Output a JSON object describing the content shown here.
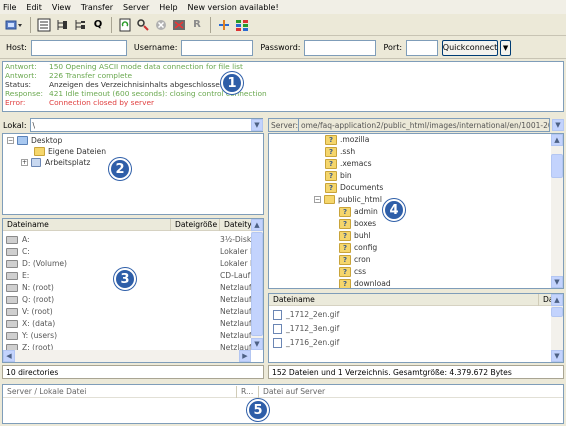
{
  "menu": [
    "File",
    "Edit",
    "View",
    "Transfer",
    "Server",
    "Help",
    "New version available!"
  ],
  "toolbar": {
    "icons": [
      "site-manager-icon",
      "dropdown-arrow-icon",
      "toggle-log-icon",
      "toggle-local-tree-icon",
      "toggle-remote-tree-icon",
      "toggle-queue-icon",
      "refresh-icon",
      "process-queue-icon",
      "cancel-icon",
      "disconnect-icon",
      "reconnect-icon",
      "filter-icon",
      "compare-icon"
    ],
    "queue_glyph": "Q",
    "reconnect_glyph": "R"
  },
  "quickconnect": {
    "host_label": "Host:",
    "username_label": "Username:",
    "password_label": "Password:",
    "port_label": "Port:",
    "host_value": "",
    "username_value": "",
    "password_value": "",
    "port_value": "",
    "button_label": "Quickconnect",
    "dropdown_glyph": "▼"
  },
  "log": [
    {
      "label": "Antwort:",
      "text": "150 Opening ASCII mode data connection for file list",
      "color": "#6aa84f"
    },
    {
      "label": "Antwort:",
      "text": "226 Transfer complete",
      "color": "#6aa84f"
    },
    {
      "label": "Status:",
      "text": "Anzeigen des Verzeichnisinhalts abgeschlossen",
      "color": "#333333"
    },
    {
      "label": "Response:",
      "text": "421 Idle timeout (600 seconds): closing control connection",
      "color": "#6aa84f"
    },
    {
      "label": "Error:",
      "text": "Connection closed by server",
      "color": "#e04040"
    }
  ],
  "local": {
    "path_label": "Lokal:",
    "path_value": "\\",
    "tree": [
      {
        "label": "Desktop",
        "sign": "−"
      },
      {
        "label": "Eigene Dateien",
        "sign": ""
      },
      {
        "label": "Arbeitsplatz",
        "sign": "+"
      }
    ],
    "columns": [
      "Dateiname",
      "Dateigröße",
      "Dateityp"
    ],
    "files": [
      {
        "name": "A:",
        "type": "3½-Disk"
      },
      {
        "name": "C:",
        "type": "Lokaler D"
      },
      {
        "name": "D: (Volume)",
        "type": "Lokaler D"
      },
      {
        "name": "E:",
        "type": "CD-Lauf"
      },
      {
        "name": "N: (root)",
        "type": "Netzlauf"
      },
      {
        "name": "Q: (root)",
        "type": "Netzlauf"
      },
      {
        "name": "V: (root)",
        "type": "Netzlauf"
      },
      {
        "name": "X: (data)",
        "type": "Netzlauf"
      },
      {
        "name": "Y: (users)",
        "type": "Netzlauf"
      },
      {
        "name": "Z: (root)",
        "type": "Netzlauf"
      }
    ],
    "status": "10 directories"
  },
  "remote": {
    "path_label": "Server:",
    "path_value": "ome/faq-application2/public_html/images/international/en/1001-2000",
    "tree": [
      {
        "label": ".mozilla",
        "indent": 0
      },
      {
        "label": ".ssh",
        "indent": 0
      },
      {
        "label": ".xemacs",
        "indent": 0
      },
      {
        "label": "bin",
        "indent": 0
      },
      {
        "label": "Documents",
        "indent": 0
      },
      {
        "label": "public_html",
        "indent": 0,
        "open": true
      },
      {
        "label": "admin",
        "indent": 1
      },
      {
        "label": "boxes",
        "indent": 1
      },
      {
        "label": "buhl",
        "indent": 1
      },
      {
        "label": "config",
        "indent": 1
      },
      {
        "label": "cron",
        "indent": 1
      },
      {
        "label": "css",
        "indent": 1
      },
      {
        "label": "download",
        "indent": 1
      },
      {
        "label": "...",
        "indent": 1
      }
    ],
    "columns": [
      "Dateiname",
      "Da"
    ],
    "files": [
      "_1712_2en.gif",
      "_1712_3en.gif",
      "_1716_2en.gif"
    ],
    "status": "152 Dateien und 1 Verzeichnis. Gesamtgröße: 4.379.672 Bytes"
  },
  "queue": {
    "columns": [
      "Server / Lokale Datei",
      "R...",
      "Datei auf Server"
    ]
  },
  "badges": [
    "1",
    "2",
    "3",
    "4",
    "5"
  ],
  "colors": {
    "badge": "#2e5ea8",
    "scroll": "#c3d3fd"
  }
}
